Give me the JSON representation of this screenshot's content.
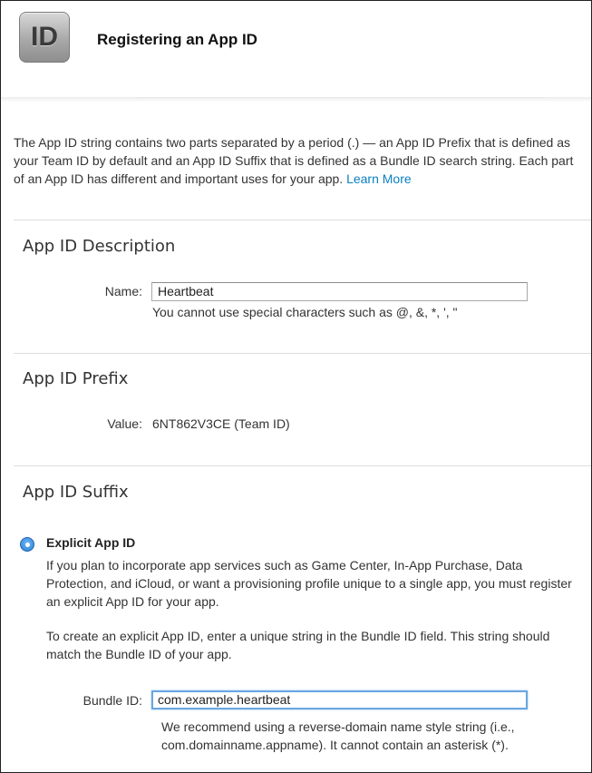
{
  "header": {
    "icon_text": "ID",
    "title": "Registering an App ID"
  },
  "intro": {
    "text": "The App ID string contains two parts separated by a period (.) — an App ID Prefix that is defined as your Team ID by default and an App ID Suffix that is defined as a Bundle ID search string. Each part of an App ID has different and important uses for your app.",
    "link": "Learn More"
  },
  "description": {
    "title": "App ID Description",
    "name_label": "Name:",
    "name_value": "Heartbeat",
    "hint": "You cannot use special characters such as @, &, *, ', \""
  },
  "prefix": {
    "title": "App ID Prefix",
    "value_label": "Value:",
    "value": "6NT862V3CE (Team ID)"
  },
  "suffix": {
    "title": "App ID Suffix",
    "explicit_label": "Explicit App ID",
    "explicit_selected": true,
    "para1": "If you plan to incorporate app services such as Game Center, In-App Purchase, Data Protection, and iCloud, or want a provisioning profile unique to a single app, you must register an explicit App ID for your app.",
    "para2": "To create an explicit App ID, enter a unique string in the Bundle ID field. This string should match the Bundle ID of your app.",
    "bundle_label": "Bundle ID:",
    "bundle_value": "com.example.heartbeat",
    "bundle_hint": "We recommend using a reverse-domain name style string (i.e., com.domainname.appname). It cannot contain an asterisk (*)."
  },
  "colors": {
    "link": "#0a7fc2",
    "radio": "#2a7fd4",
    "focus_ring": "#6aa6e0"
  }
}
